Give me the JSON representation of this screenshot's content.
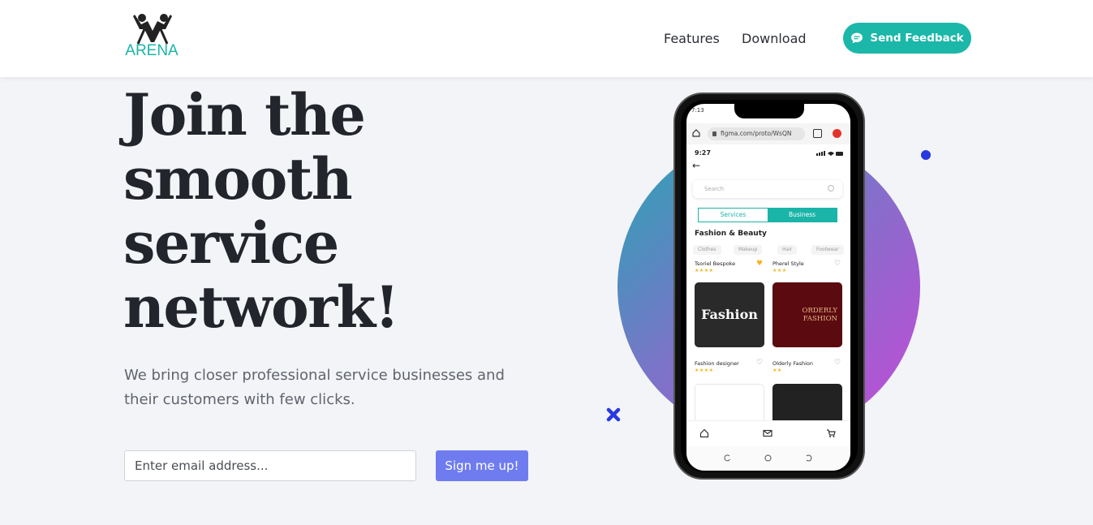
{
  "header": {
    "logo_text": "ARENA",
    "nav": [
      {
        "label": "Features"
      },
      {
        "label": "Download"
      }
    ],
    "feedback_label": "Send Feedback"
  },
  "hero": {
    "title_lines": [
      "Join the",
      "smooth",
      "service",
      "network!"
    ],
    "subtitle_line1": "We bring closer professional service businesses and",
    "subtitle_line2": "their customers with few clicks.",
    "email_placeholder": "Enter email address...",
    "signup_label": "Sign me up!"
  },
  "colors": {
    "accent_teal": "#1bb7a9",
    "button_violet": "#6f7cf0",
    "blob_start": "#25a7b4",
    "blob_end": "#c54ad8",
    "dot_blue": "#2839e0"
  },
  "phone": {
    "os_time": "7:13",
    "url": "figma.com/proto/WsQN",
    "app_time": "9:27",
    "search_placeholder": "Search",
    "segments": [
      "Services",
      "Business"
    ],
    "section_title": "Fashion & Beauty",
    "chips": [
      "Clothes",
      "Makeup",
      "Hair",
      "Footwear"
    ],
    "businesses": [
      {
        "name": "Tsoriel Bespoke",
        "stars": "★★★★",
        "favorite": true
      },
      {
        "name": "Pherel Style",
        "stars": "★★★",
        "favorite": false
      },
      {
        "name": "Fashion designer",
        "stars": "★★★★",
        "favorite": false
      },
      {
        "name": "Olderly Fashion",
        "stars": "★★",
        "favorite": false
      }
    ],
    "card_a_text": "Fashion",
    "card_b_text": "ORDERLY FASHION",
    "tab_icons": [
      "home-icon",
      "mail-icon",
      "cart-icon"
    ]
  }
}
